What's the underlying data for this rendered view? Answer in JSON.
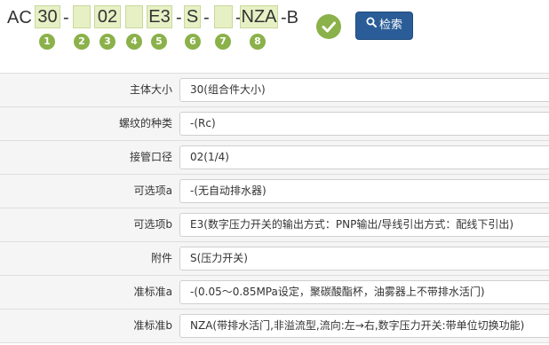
{
  "model_code": {
    "prefix": "AC",
    "suffix": "-B",
    "separators": [
      "-",
      "-",
      "-",
      "-"
    ],
    "segments": [
      {
        "number": "1",
        "value": "30"
      },
      {
        "number": "2",
        "value": ""
      },
      {
        "number": "3",
        "value": "02"
      },
      {
        "number": "4",
        "value": ""
      },
      {
        "number": "5",
        "value": "E3"
      },
      {
        "number": "6",
        "value": "S"
      },
      {
        "number": "7",
        "value": ""
      },
      {
        "number": "8",
        "value": "NZA"
      }
    ]
  },
  "status_icon": "check-circle-icon",
  "search_button": {
    "icon": "search-icon",
    "label": "检索",
    "color": "#2a5d98"
  },
  "accent_color": "#8bb14a",
  "segment_fill": "#e6f0c4",
  "spec_rows": [
    {
      "label": "主体大小",
      "value": "30(组合件大小)"
    },
    {
      "label": "螺纹的种类",
      "value": "-(Rc)"
    },
    {
      "label": "接管口径",
      "value": "02(1/4)"
    },
    {
      "label": "可选项a",
      "value": "-(无自动排水器)"
    },
    {
      "label": "可选项b",
      "value": "E3(数字压力开关的输出方式：PNP输出/导线引出方式：配线下引出)"
    },
    {
      "label": "附件",
      "value": "S(压力开关)"
    },
    {
      "label": "准标准a",
      "value": "-(0.05～0.85MPa设定，聚碳酸酯杯，油雾器上不带排水活门)"
    },
    {
      "label": "准标准b",
      "value": "NZA(带排水活门,非溢流型,流向:左→右,数字压力开关:带单位切换功能)"
    }
  ]
}
